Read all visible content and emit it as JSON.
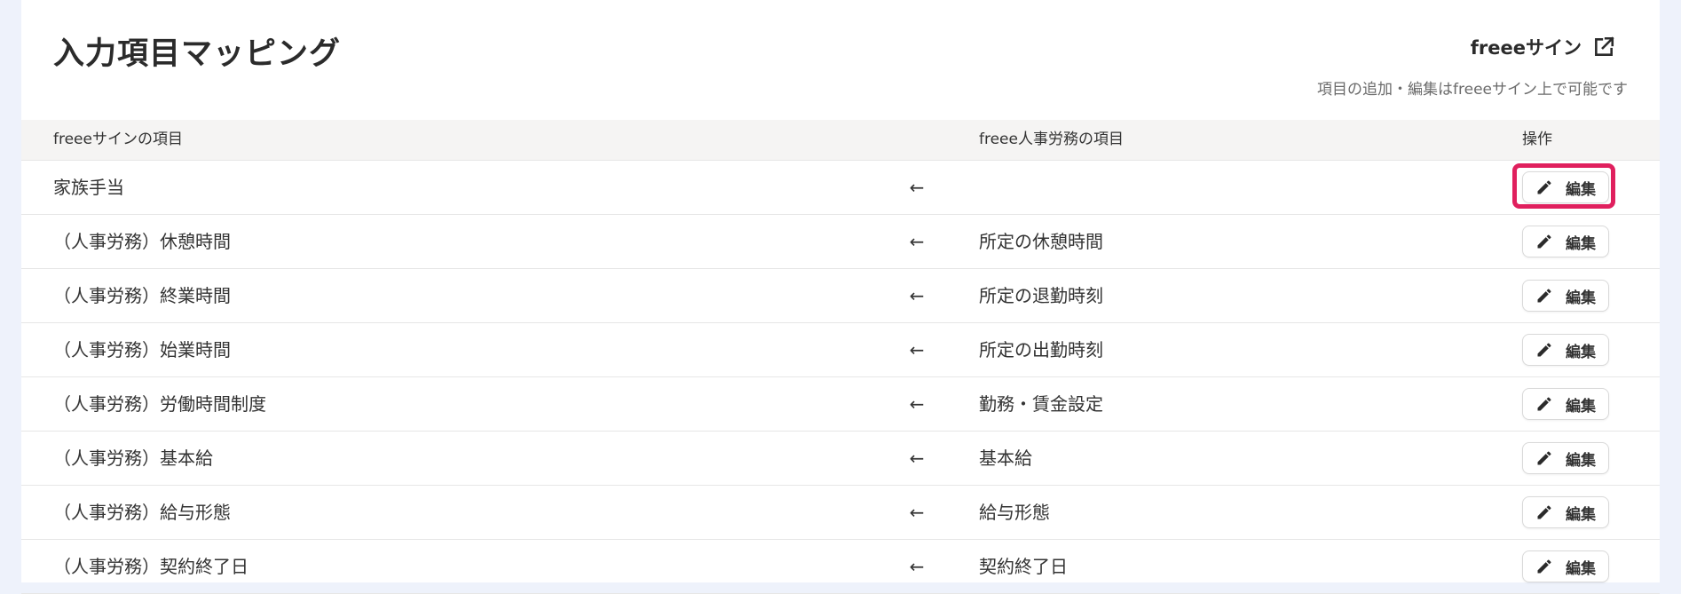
{
  "header": {
    "title": "入力項目マッピング",
    "external_link_label": "freeeサイン",
    "external_link_icon": "external-link-icon",
    "hint": "項目の追加・編集はfreeeサイン上で可能です"
  },
  "table": {
    "columns": {
      "source": "freeeサインの項目",
      "target": "freee人事労務の項目",
      "action": "操作"
    },
    "arrow": "←",
    "edit_label": "編集",
    "edit_icon": "pencil-icon",
    "rows": [
      {
        "source": "家族手当",
        "target": "",
        "highlighted": true
      },
      {
        "source": "（人事労務）休憩時間",
        "target": "所定の休憩時間"
      },
      {
        "source": "（人事労務）終業時間",
        "target": "所定の退勤時刻"
      },
      {
        "source": "（人事労務）始業時間",
        "target": "所定の出勤時刻"
      },
      {
        "source": "（人事労務）労働時間制度",
        "target": "勤務・賃金設定"
      },
      {
        "source": "（人事労務）基本給",
        "target": "基本給"
      },
      {
        "source": "（人事労務）給与形態",
        "target": "給与形態"
      },
      {
        "source": "（人事労務）契約終了日",
        "target": "契約終了日"
      }
    ]
  },
  "colors": {
    "highlight": "#e0205e",
    "background": "#eef2fb",
    "header_row": "#f5f4f3"
  }
}
